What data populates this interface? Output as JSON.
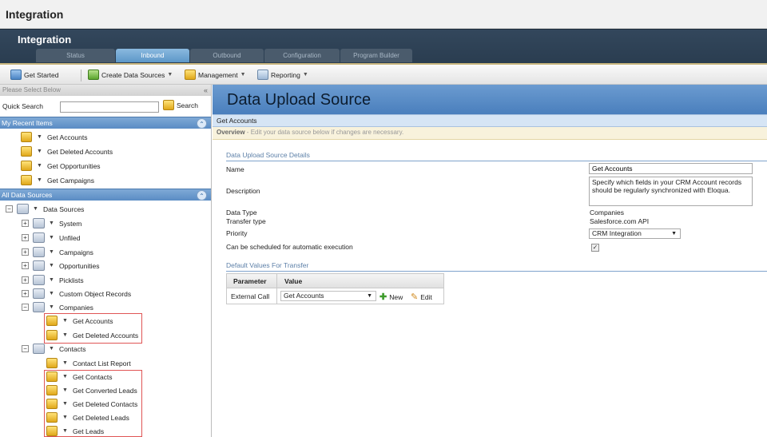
{
  "app": {
    "title": "Integration"
  },
  "banner": {
    "title": "Integration",
    "tabs": [
      {
        "label": "Status",
        "active": false
      },
      {
        "label": "Inbound",
        "active": true
      },
      {
        "label": "Outbound",
        "active": false
      },
      {
        "label": "Configuration",
        "active": false
      },
      {
        "label": "Program Builder",
        "active": false
      }
    ]
  },
  "toolbar": {
    "get_started": "Get Started",
    "create_data_sources": "Create Data Sources",
    "management": "Management",
    "reporting": "Reporting"
  },
  "left": {
    "header": "Please Select Below",
    "collapse": "«",
    "quick_search_label": "Quick Search",
    "quick_search_value": "",
    "search_button": "Search",
    "recent_title": "My Recent Items",
    "recent": [
      "Get Accounts",
      "Get Deleted Accounts",
      "Get Opportunities",
      "Get Campaigns"
    ],
    "all_title": "All Data Sources",
    "tree": {
      "root": "Data Sources",
      "folders": [
        "System",
        "Unfiled",
        "Campaigns",
        "Opportunities",
        "Picklists",
        "Custom Object Records"
      ],
      "companies": "Companies",
      "companies_items": [
        "Get Accounts",
        "Get Deleted Accounts"
      ],
      "contacts": "Contacts",
      "contact_list_report": "Contact List Report",
      "contacts_items": [
        "Get Contacts",
        "Get Converted Leads",
        "Get Deleted Contacts",
        "Get Deleted Leads",
        "Get Leads"
      ]
    }
  },
  "main": {
    "title": "Data Upload Source",
    "subtitle": "Get Accounts",
    "overview_label": "Overview",
    "overview_text": "Edit your data source below if changes are necessary.",
    "details_header": "Data Upload Source Details",
    "fields": {
      "name_label": "Name",
      "name_value": "Get Accounts",
      "description_label": "Description",
      "description_value": "Specify which fields in your CRM Account records should be regularly synchronized with Eloqua.",
      "data_type_label": "Data Type",
      "data_type_value": "Companies",
      "transfer_type_label": "Transfer type",
      "transfer_type_value": "Salesforce.com API",
      "priority_label": "Priority",
      "priority_value": "CRM Integration",
      "schedulable_label": "Can be scheduled for automatic execution",
      "schedulable_checked": true
    },
    "defaults_header": "Default Values For Transfer",
    "table": {
      "col_parameter": "Parameter",
      "col_value": "Value",
      "row_parameter": "External Call",
      "row_value": "Get Accounts",
      "new_label": "New",
      "edit_label": "Edit"
    }
  }
}
